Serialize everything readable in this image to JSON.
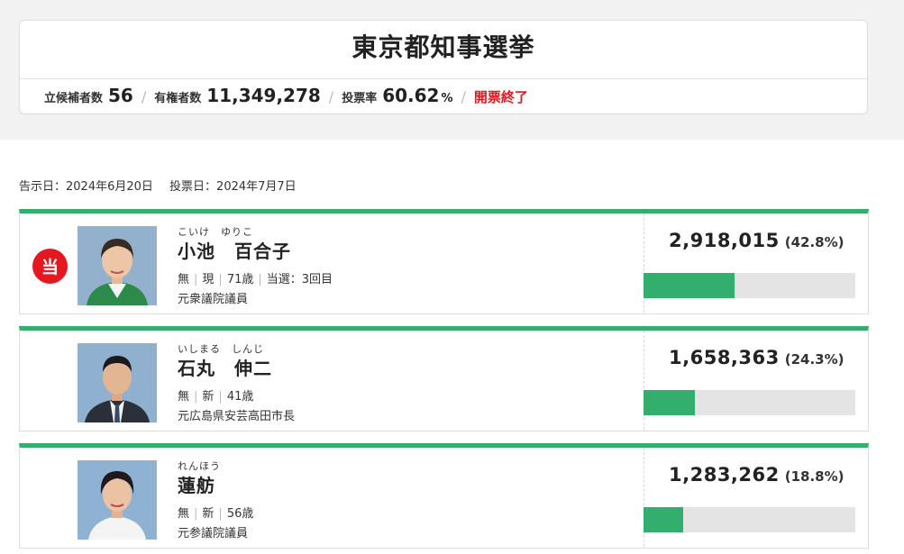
{
  "title": "東京都知事選挙",
  "stats": {
    "candidates_label": "立候補者数",
    "candidates_value": "56",
    "voters_label": "有権者数",
    "voters_value": "11,349,278",
    "turnout_label": "投票率",
    "turnout_value": "60.62",
    "turnout_unit": "%",
    "status": "開票終了"
  },
  "dates": {
    "announcement": "告示日：2024年6月20日",
    "voting": "投票日：2024年7月7日"
  },
  "elected_mark": "当",
  "candidates": [
    {
      "kana": "こいけ　ゆりこ",
      "name": "小池　百合子",
      "party": "無",
      "status": "現",
      "age": "71歳",
      "wins": "当選：3回目",
      "career": "元衆議院議員",
      "votes": "2,918,015",
      "percent_text": "(42.8%)",
      "bar_fraction": 0.428,
      "elected": true
    },
    {
      "kana": "いしまる　しんじ",
      "name": "石丸　伸二",
      "party": "無",
      "status": "新",
      "age": "41歳",
      "career": "元広島県安芸高田市長",
      "votes": "1,658,363",
      "percent_text": "(24.3%)",
      "bar_fraction": 0.243,
      "elected": false
    },
    {
      "kana": "れんほう",
      "name": "蓮舫",
      "party": "無",
      "status": "新",
      "age": "56歳",
      "career": "元参議院議員",
      "votes": "1,283,262",
      "percent_text": "(18.8%)",
      "bar_fraction": 0.188,
      "elected": false
    }
  ],
  "colors": {
    "accent_green": "#33ae6c",
    "elected_red": "#e5171f",
    "bar_track": "#e4e4e4"
  }
}
